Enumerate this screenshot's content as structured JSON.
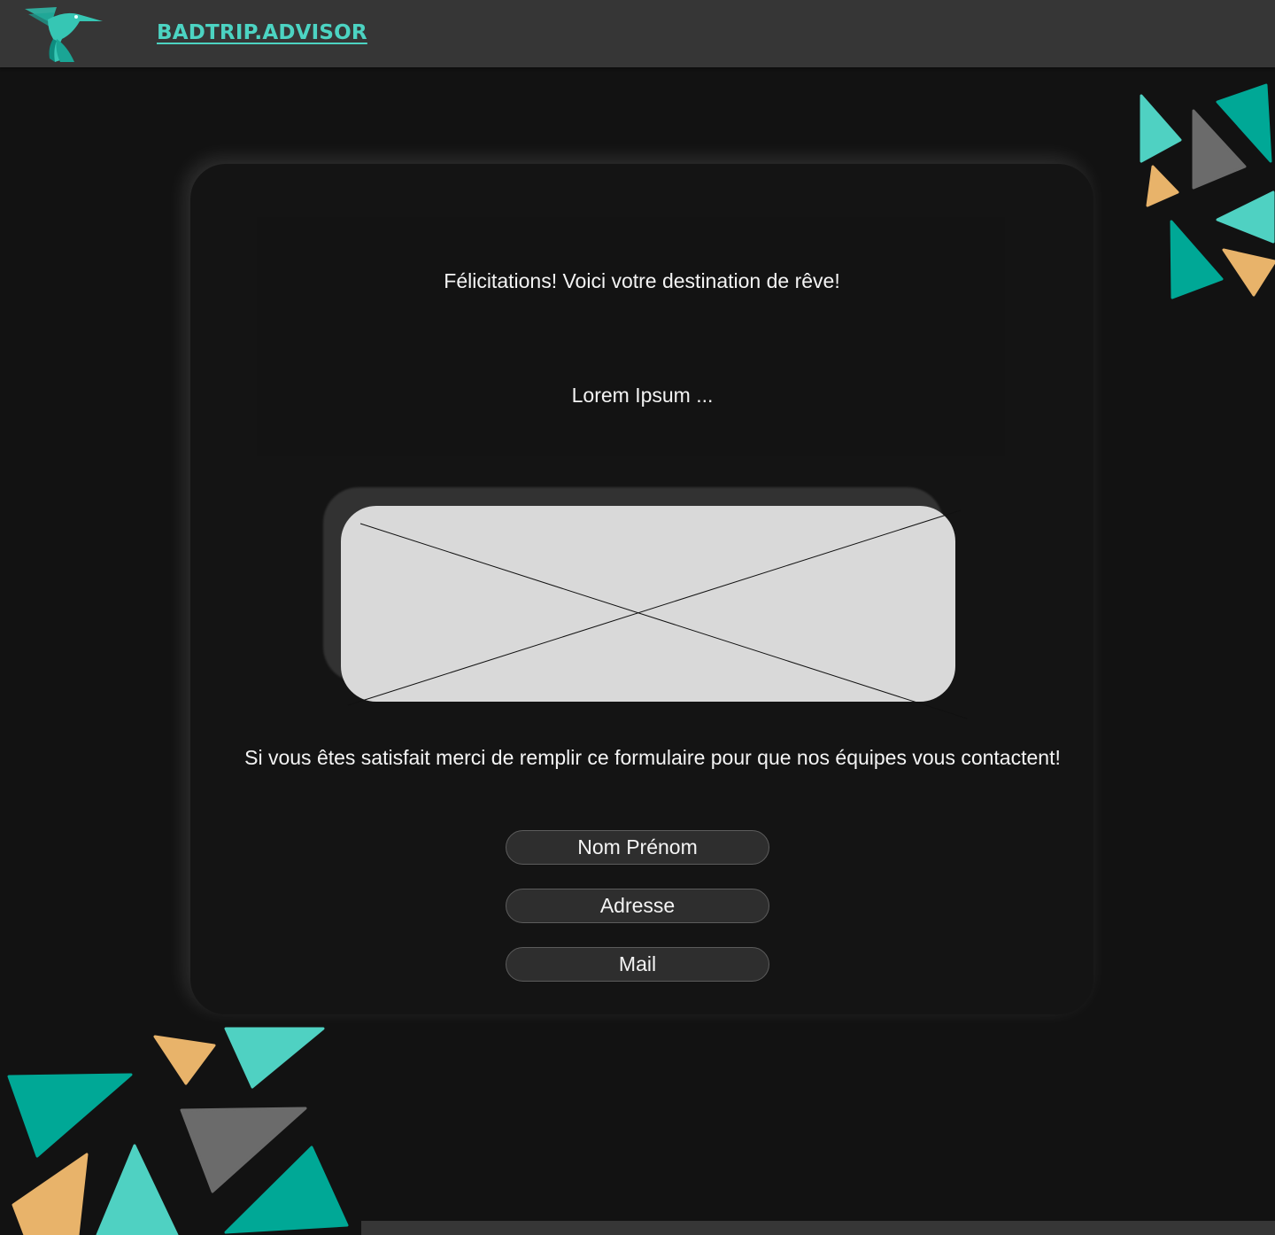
{
  "header": {
    "brand": "BADTRIP.ADVISOR",
    "logo_icon": "hummingbird-icon"
  },
  "colors": {
    "accent_teal": "#4cd3c2",
    "teal_dark": "#00a896",
    "orange": "#e8b36a",
    "gray": "#6b6b6b",
    "background": "#121212",
    "header_bg": "#363636"
  },
  "main": {
    "title": "Félicitations! Voici votre destination de rêve!",
    "description": "Lorem Ipsum ...",
    "image": "image-placeholder-icon",
    "message": "Si vous êtes satisfait merci de remplir ce formulaire pour que nos équipes vous contactent!",
    "form": {
      "name_placeholder": "Nom Prénom",
      "address_placeholder": "Adresse",
      "mail_placeholder": "Mail"
    }
  }
}
